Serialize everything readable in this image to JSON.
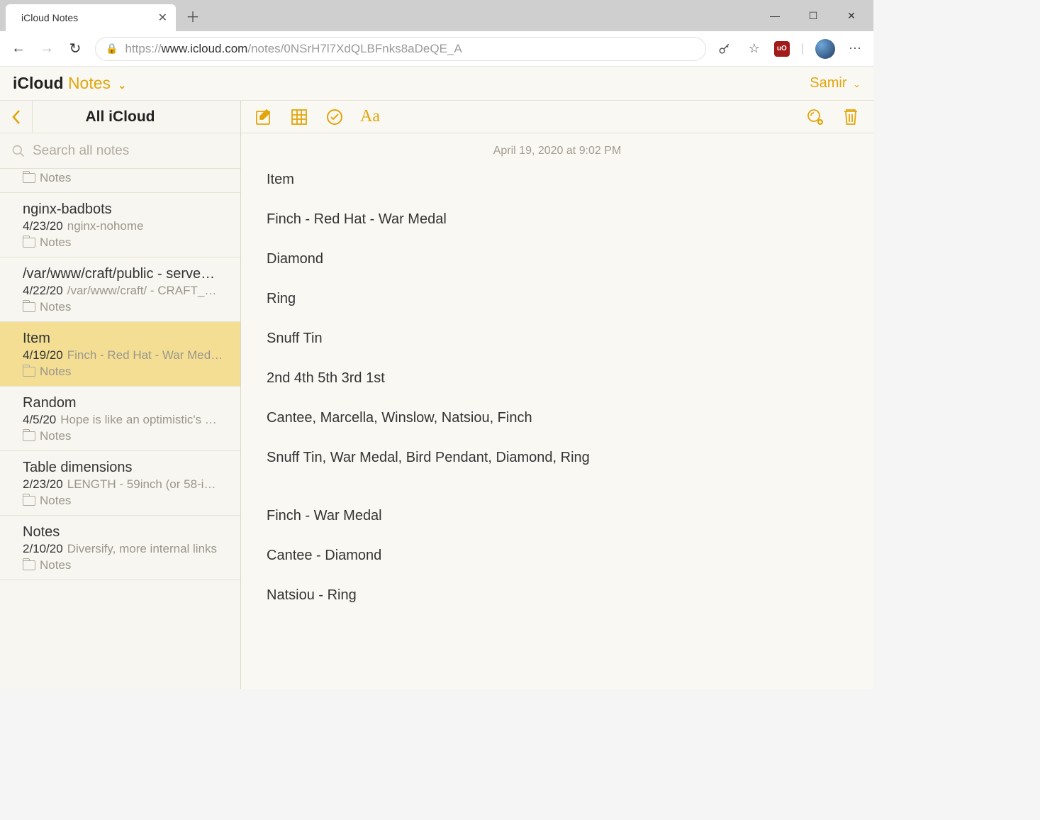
{
  "browser": {
    "tab_title": "iCloud Notes",
    "url_prefix": "https://",
    "url_host": "www.icloud.com",
    "url_path": "/notes/0NSrH7l7XdQLBFnks8aDeQE_A"
  },
  "app": {
    "brand_icloud": "iCloud",
    "brand_notes": "Notes",
    "user": "Samir"
  },
  "sidebar": {
    "title": "All iCloud",
    "search_placeholder": "Search all notes",
    "items": [
      {
        "title": "",
        "date": "",
        "preview": "",
        "folder": "Notes",
        "partial": true
      },
      {
        "title": "nginx-badbots",
        "date": "4/23/20",
        "preview": "nginx-nohome",
        "folder": "Notes"
      },
      {
        "title": "/var/www/craft/public - serve…",
        "date": "4/22/20",
        "preview": "/var/www/craft/ - CRAFT_…",
        "folder": "Notes"
      },
      {
        "title": "Item",
        "date": "4/19/20",
        "preview": "Finch - Red Hat - War Med…",
        "folder": "Notes",
        "selected": true
      },
      {
        "title": "Random",
        "date": "4/5/20",
        "preview": "Hope is like an optimistic's …",
        "folder": "Notes"
      },
      {
        "title": "Table dimensions",
        "date": "2/23/20",
        "preview": "LENGTH - 59inch (or 58-i…",
        "folder": "Notes"
      },
      {
        "title": "Notes",
        "date": "2/10/20",
        "preview": "Diversify, more internal links",
        "folder": "Notes"
      }
    ]
  },
  "note": {
    "date": "April 19, 2020 at 9:02 PM",
    "lines": [
      "Item",
      "Finch - Red Hat - War Medal",
      "Diamond",
      "Ring",
      "Snuff Tin",
      "2nd 4th 5th 3rd 1st",
      "Cantee, Marcella, Winslow, Natsiou, Finch",
      "Snuff Tin, War Medal, Bird Pendant, Diamond, Ring",
      "",
      "Finch - War Medal",
      "Cantee - Diamond",
      "Natsiou - Ring"
    ]
  }
}
